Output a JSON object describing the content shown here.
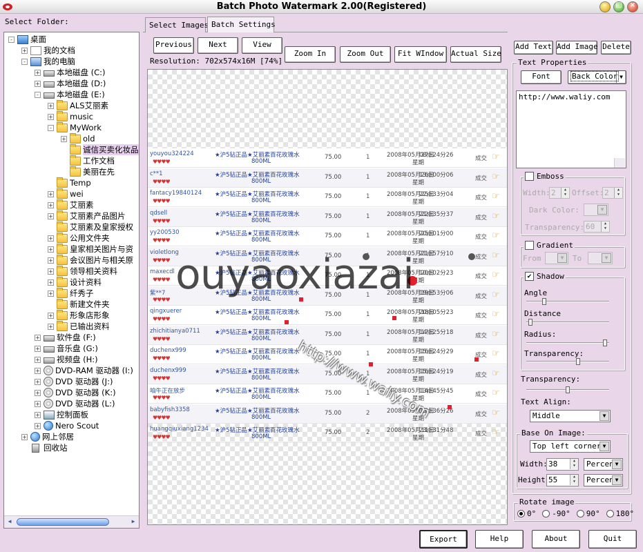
{
  "window": {
    "title": "Batch Photo Watermark 2.00(Registered)"
  },
  "folder_label": "Select Folder:",
  "tree": [
    {
      "label": "桌面",
      "icon": "desktop-icon",
      "depth": 0,
      "expander": "-"
    },
    {
      "label": "我的文档",
      "icon": "documents-icon",
      "depth": 1,
      "expander": "+"
    },
    {
      "label": "我的电脑",
      "icon": "computer-icon",
      "depth": 1,
      "expander": "-"
    },
    {
      "label": "本地磁盘 (C:)",
      "icon": "drive-icon",
      "depth": 2,
      "expander": "+"
    },
    {
      "label": "本地磁盘 (D:)",
      "icon": "drive-icon",
      "depth": 2,
      "expander": "+"
    },
    {
      "label": "本地磁盘 (E:)",
      "icon": "drive-icon",
      "depth": 2,
      "expander": "-"
    },
    {
      "label": "ALS艾丽素",
      "icon": "folder-icon",
      "depth": 3,
      "expander": "+"
    },
    {
      "label": "music",
      "icon": "folder-icon",
      "depth": 3,
      "expander": "+"
    },
    {
      "label": "MyWork",
      "icon": "folder-icon",
      "depth": 3,
      "expander": "-"
    },
    {
      "label": "old",
      "icon": "folder-icon",
      "depth": 4,
      "expander": "+"
    },
    {
      "label": "诚信买卖化妆品",
      "icon": "folder-icon",
      "depth": 4,
      "expander": "",
      "selected": true
    },
    {
      "label": "工作文档",
      "icon": "folder-icon",
      "depth": 4,
      "expander": ""
    },
    {
      "label": "美丽在先",
      "icon": "folder-icon",
      "depth": 4,
      "expander": ""
    },
    {
      "label": "Temp",
      "icon": "folder-icon",
      "depth": 3,
      "expander": ""
    },
    {
      "label": "wei",
      "icon": "folder-icon",
      "depth": 3,
      "expander": "+"
    },
    {
      "label": "艾丽素",
      "icon": "folder-icon",
      "depth": 3,
      "expander": "+"
    },
    {
      "label": "艾丽素产品图片",
      "icon": "folder-icon",
      "depth": 3,
      "expander": "+"
    },
    {
      "label": "艾丽素及皇家授权",
      "icon": "folder-icon",
      "depth": 3,
      "expander": ""
    },
    {
      "label": "公用文件夹",
      "icon": "folder-icon",
      "depth": 3,
      "expander": "+"
    },
    {
      "label": "皇家相关图片与资",
      "icon": "folder-icon",
      "depth": 3,
      "expander": "+"
    },
    {
      "label": "会议图片与相关原",
      "icon": "folder-icon",
      "depth": 3,
      "expander": "+"
    },
    {
      "label": "领导相关资料",
      "icon": "folder-icon",
      "depth": 3,
      "expander": "+"
    },
    {
      "label": "设计资料",
      "icon": "folder-icon",
      "depth": 3,
      "expander": "+"
    },
    {
      "label": "纤秀子",
      "icon": "folder-icon",
      "depth": 3,
      "expander": "+"
    },
    {
      "label": "新建文件夹",
      "icon": "folder-icon",
      "depth": 3,
      "expander": ""
    },
    {
      "label": "形象店形象",
      "icon": "folder-icon",
      "depth": 3,
      "expander": "+"
    },
    {
      "label": "已输出资料",
      "icon": "folder-icon",
      "depth": 3,
      "expander": "+"
    },
    {
      "label": "软件盘 (F:)",
      "icon": "drive-icon",
      "depth": 2,
      "expander": "+"
    },
    {
      "label": "音乐盘 (G:)",
      "icon": "drive-icon",
      "depth": 2,
      "expander": "+"
    },
    {
      "label": "视频盘 (H:)",
      "icon": "drive-icon",
      "depth": 2,
      "expander": "+"
    },
    {
      "label": "DVD-RAM 驱动器 (I:)",
      "icon": "dvd-icon",
      "depth": 2,
      "expander": "+"
    },
    {
      "label": "DVD 驱动器 (J:)",
      "icon": "dvd-icon",
      "depth": 2,
      "expander": "+"
    },
    {
      "label": "DVD 驱动器 (K:)",
      "icon": "dvd-icon",
      "depth": 2,
      "expander": "+"
    },
    {
      "label": "DVD 驱动器 (L:)",
      "icon": "dvd-icon",
      "depth": 2,
      "expander": "+"
    },
    {
      "label": "控制面板",
      "icon": "control-panel-icon",
      "depth": 2,
      "expander": "+"
    },
    {
      "label": "Nero Scout",
      "icon": "globe-icon",
      "depth": 2,
      "expander": "+"
    },
    {
      "label": "网上邻居",
      "icon": "network-icon",
      "depth": 1,
      "expander": "+"
    },
    {
      "label": "回收站",
      "icon": "recycle-bin-icon",
      "depth": 1,
      "expander": ""
    }
  ],
  "tabs": [
    {
      "label": "Select Images",
      "active": false
    },
    {
      "label": "Batch Settings",
      "active": true
    }
  ],
  "nav": {
    "previous": "Previous",
    "next": "Next",
    "view": "View"
  },
  "zoom": {
    "zoom_in": "Zoom In",
    "zoom_out": "Zoom Out",
    "fit_window": "Fit WIndow",
    "actual_size": "Actual Size"
  },
  "resolution": "Resolution: 702x574x16M",
  "zoom_percent": "[74%]",
  "preview": {
    "watermark_text": "ouyaoxiazai",
    "watermark_url": "http://www.waliy.com",
    "rows": [
      {
        "user": "youyou324224",
        "item": "★沪5钻正品★艾丽素百花玫瑰水",
        "size": "800ML",
        "price": "75.00",
        "qty": "1",
        "date": "2008年05月27日",
        "date2": "星期",
        "time": "08点24分26",
        "status": "成交"
      },
      {
        "user": "c**1",
        "item": "★沪5钻正品★艾丽素百花玫瑰水",
        "size": "800ML",
        "price": "75.00",
        "qty": "1",
        "date": "2008年05月26日",
        "date2": "星期",
        "time": "13点00分06",
        "status": "成交"
      },
      {
        "user": "fantacy19840124",
        "item": "★沪5钻正品★艾丽素百花玫瑰水",
        "size": "800ML",
        "price": "75.00",
        "qty": "1",
        "date": "2008年05月25日",
        "date2": "星期",
        "time": "22点33分04",
        "status": "成交"
      },
      {
        "user": "qdsell",
        "item": "★沪5钻正品★艾丽素百花玫瑰水",
        "size": "800ML",
        "price": "75.00",
        "qty": "1",
        "date": "2008年05月22日",
        "date2": "星期",
        "time": "21点35分37",
        "status": "成交"
      },
      {
        "user": "yy200530",
        "item": "★沪5钻正品★艾丽素百花玫瑰水",
        "size": "800ML",
        "price": "75.00",
        "qty": "1",
        "date": "2008年05月25日",
        "date2": "星期",
        "time": "20点01分00",
        "status": "成交"
      },
      {
        "user": "violetlong",
        "item": "★沪5钻正品★艾丽素百花玫瑰水",
        "size": "800ML",
        "price": "75.00",
        "qty": "1",
        "date": "2008年05月21日",
        "date2": "星期",
        "time": "21点57分10",
        "status": "成交"
      },
      {
        "user": "maxecdl",
        "item": "★沪5钻正品★艾丽素百花玫瑰水",
        "size": "800ML",
        "price": "75.00",
        "qty": "1",
        "date": "2008年05月20日",
        "date2": "星期",
        "time": "10点02分23",
        "status": "成交"
      },
      {
        "user": "紫**7",
        "item": "★沪5钻正品★艾丽素百花玫瑰水",
        "size": "800ML",
        "price": "75.00",
        "qty": "1",
        "date": "2008年05月19日",
        "date2": "星期",
        "time": "19点53分06",
        "status": "成交"
      },
      {
        "user": "qingxuerer",
        "item": "★沪5钻正品★艾丽素百花玫瑰水",
        "size": "800ML",
        "price": "75.00",
        "qty": "1",
        "date": "2008年05月18日",
        "date2": "星期",
        "time": "20点05分23",
        "status": "成交"
      },
      {
        "user": "zhichitianya0711",
        "item": "★沪5钻正品★艾丽素百花玫瑰水",
        "size": "800ML",
        "price": "75.00",
        "qty": "1",
        "date": "2008年05月17日",
        "date2": "星期",
        "time": "14点25分18",
        "status": "成交"
      },
      {
        "user": "duchenx999",
        "item": "★沪5钻正品★艾丽素百花玫瑰水",
        "size": "800ML",
        "price": "75.00",
        "qty": "1",
        "date": "2008年05月16日",
        "date2": "星期",
        "time": "15点24分29",
        "status": "成交"
      },
      {
        "user": "duchenx999",
        "item": "★沪5钻正品★艾丽素百花玫瑰水",
        "size": "800ML",
        "price": "75.00",
        "qty": "1",
        "date": "2008年05月16日",
        "date2": "星期",
        "time": "15点24分19",
        "status": "成交"
      },
      {
        "user": "咱牛正在放步",
        "item": "★沪5钻正品★艾丽素百花玫瑰水",
        "size": "800ML",
        "price": "75.00",
        "qty": "1",
        "date": "2008年05月14日",
        "date2": "星期",
        "time": "13点45分45",
        "status": "成交"
      },
      {
        "user": "babyfish3358",
        "item": "★沪5钻正品★艾丽素百花玫瑰水",
        "size": "800ML",
        "price": "75.00",
        "qty": "2",
        "date": "2008年05月13日",
        "date2": "星期",
        "time": "13点36分26",
        "status": "成交"
      },
      {
        "user": "huangqiuxiang1234",
        "item": "★沪5钻正品★艾丽素百花玫瑰水",
        "size": "800ML",
        "price": "75.00",
        "qty": "2",
        "date": "2008年05月11日",
        "date2": "星期",
        "time": "23点31分48",
        "status": "成交"
      }
    ]
  },
  "right": {
    "add_text": "Add Text",
    "add_image": "Add Image",
    "delete": "Delete",
    "text_properties": "Text Properties",
    "font": "Font",
    "back_color": "Back Color",
    "text_value": "http://www.waliy.com",
    "emboss": "Emboss",
    "width_label": "Width:",
    "width_value": "2",
    "offset_label": "Offset:",
    "offset_value": "2",
    "dark_color": "Dark Color:",
    "transparency_label": "Transparency:",
    "emboss_transparency": "60",
    "gradient": "Gradient",
    "from": "From",
    "to": "To",
    "shadow": "Shadow",
    "shadow_checked": true,
    "angle": "Angle",
    "distance": "Distance",
    "radius": "Radius:",
    "shadow_transparency": "Transparency:",
    "angle_level": 0.2,
    "distance_level": 0.03,
    "radius_level": 0.97,
    "shadow_transparency_level": 0.63,
    "text_transparency": "Transparency:",
    "text_transparency_level": 0.5,
    "text_align_label": "Text Align:",
    "text_align": "Middle",
    "base_on_image": "Base On Image:",
    "position": "Top left corner",
    "width_field_label": "Width:",
    "width_field": "38",
    "width_unit": "Percen",
    "height_field_label": "Height:",
    "height_field": "55",
    "height_unit": "Percen",
    "rotate_image": "Rotate image",
    "rotations": [
      "0°",
      "-90°",
      "90°",
      "180°"
    ],
    "rotation_selected": "0°"
  },
  "footer": {
    "export": "Export",
    "help": "Help",
    "about": "About",
    "quit": "Quit"
  },
  "colors": {
    "background": "#e9d6e9",
    "heart": "#d43333",
    "link_blue": "#1f3d9a",
    "watermark_red": "#e0202a"
  }
}
